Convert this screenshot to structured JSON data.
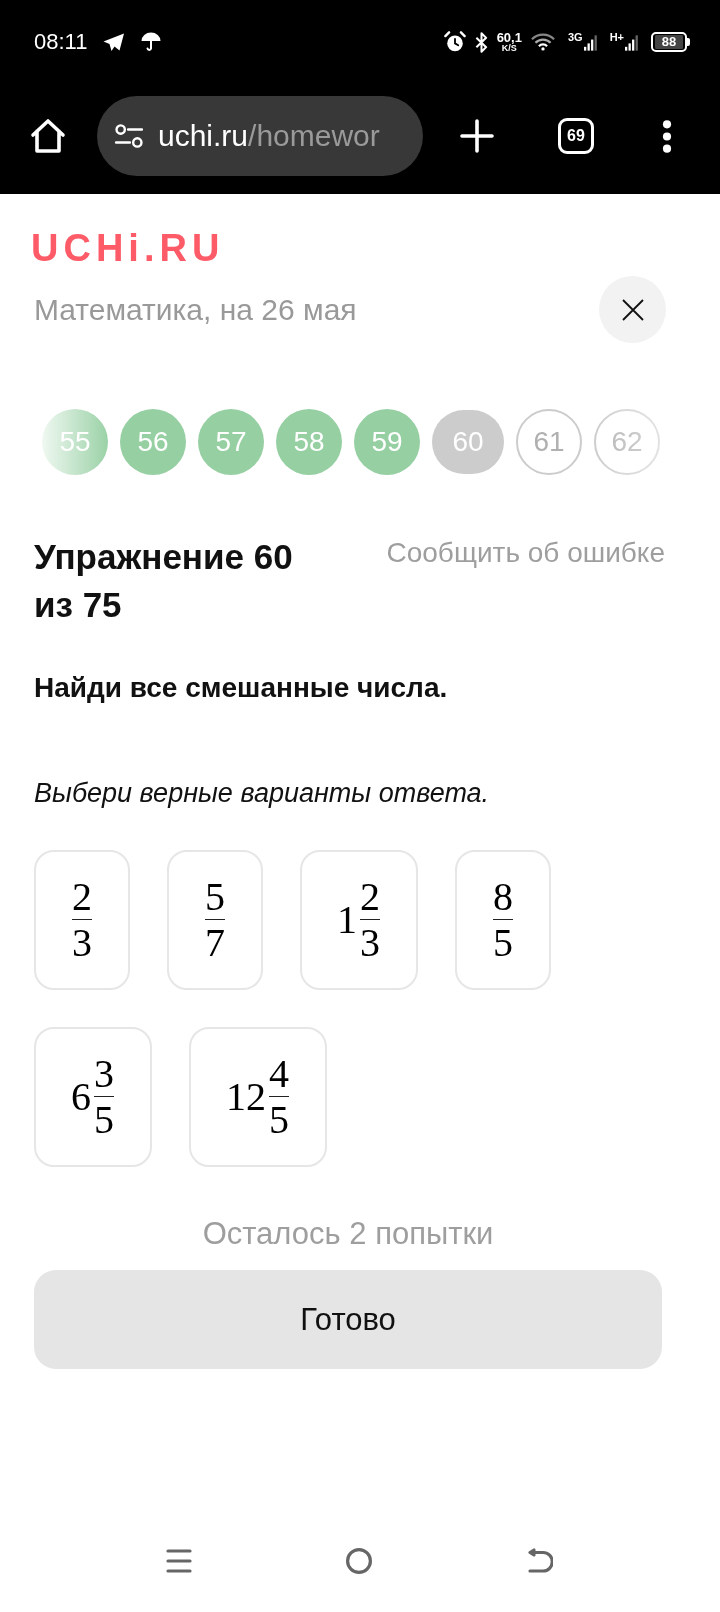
{
  "status_bar": {
    "time": "08:11",
    "network_speed": "60,1",
    "network_speed_unit": "K/S",
    "network_type_1": "3G",
    "network_type_2": "H+",
    "battery": "88"
  },
  "browser": {
    "url_host": "uchi.ru",
    "url_path": "/homewor",
    "tab_count": "69"
  },
  "header": {
    "logo": "UCHi.RU",
    "subtitle": "Математика, на 26 мая"
  },
  "progress": {
    "items": [
      {
        "label": "55",
        "done": true,
        "selected": false
      },
      {
        "label": "56",
        "done": true,
        "selected": false
      },
      {
        "label": "57",
        "done": true,
        "selected": false
      },
      {
        "label": "58",
        "done": true,
        "selected": false
      },
      {
        "label": "59",
        "done": true,
        "selected": false
      },
      {
        "label": "60",
        "done": false,
        "selected": true
      },
      {
        "label": "61",
        "done": false,
        "selected": false
      },
      {
        "label": "62",
        "done": false,
        "selected": false
      }
    ]
  },
  "exercise": {
    "title": "Упражнение 60 из 75",
    "report_link": "Сообщить об ошибке",
    "task": "Найди все смешанные числа.",
    "instruction": "Выбери верные варианты ответа.",
    "options": [
      {
        "numerator": "2",
        "denominator": "3",
        "selected": false
      },
      {
        "numerator": "5",
        "denominator": "7",
        "selected": false
      },
      {
        "whole": "1",
        "numerator": "2",
        "denominator": "3",
        "selected": false
      },
      {
        "numerator": "8",
        "denominator": "5",
        "selected": false
      },
      {
        "whole": "6",
        "numerator": "3",
        "denominator": "5",
        "selected": false
      },
      {
        "whole": "12",
        "numerator": "4",
        "denominator": "5",
        "selected": false
      }
    ],
    "attempts_left": "Осталось 2 попытки",
    "submit_button": "Готово"
  }
}
